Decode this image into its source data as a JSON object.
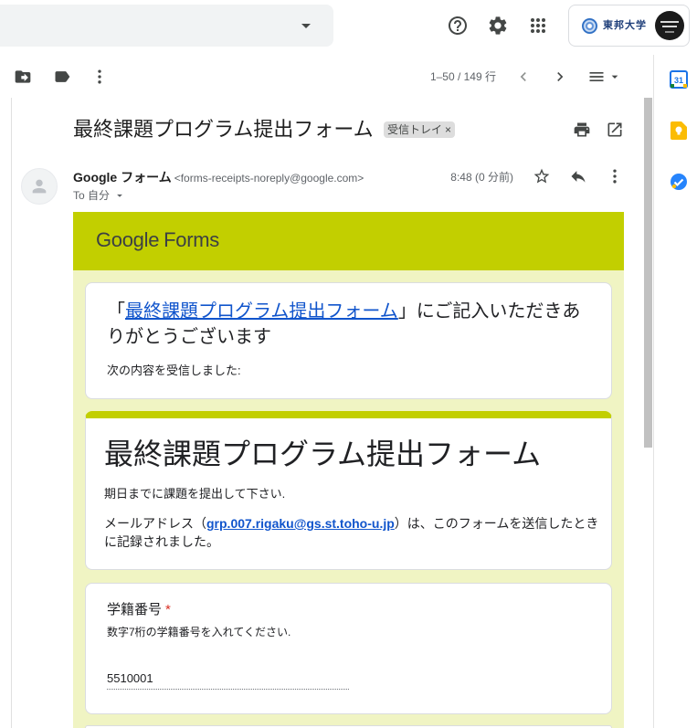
{
  "header": {
    "account": {
      "org_name": "東邦大学"
    },
    "icons": [
      "search-options-icon",
      "help-icon",
      "settings-icon",
      "apps-icon"
    ]
  },
  "toolbar": {
    "pagination": "1–50 / 149 行",
    "icons": [
      "move-to-icon",
      "label-icon",
      "more-vert-icon",
      "chevron-left-icon",
      "chevron-right-icon",
      "density-icon"
    ]
  },
  "side_panel": {
    "calendar_day": "31",
    "icons": [
      "calendar-icon",
      "keep-icon",
      "tasks-icon"
    ]
  },
  "email": {
    "subject": "最終課題プログラム提出フォーム",
    "label": "受信トレイ",
    "label_remove": "×",
    "sender_name": "Google フォーム",
    "sender_email": "<forms-receipts-noreply@google.com>",
    "time": "8:48 (0 分前)",
    "to": "To 自分",
    "icons": [
      "print-icon",
      "open-in-new-icon",
      "star-icon",
      "reply-icon",
      "more-vert-icon"
    ]
  },
  "form_email": {
    "brand": {
      "google": "Google",
      "forms": "Forms"
    },
    "thanks": {
      "open": "「",
      "link": "最終課題プログラム提出フォーム",
      "close": "」にご記入いただきありがとうございます"
    },
    "received": "次の内容を受信しました:",
    "form_title": "最終課題プログラム提出フォーム",
    "form_description": "期日までに課題を提出して下さい.",
    "email_notice": {
      "before": "メールアドレス（",
      "email": "grp.007.rigaku@gs.st.toho-u.jp",
      "after": "）は、このフォームを送信したときに記録されました。"
    },
    "questions": [
      {
        "title": "学籍番号",
        "required_mark": "*",
        "description": "数字7桁の学籍番号を入れてください.",
        "answer": "5510001"
      }
    ]
  },
  "colors": {
    "forms_accent": "#c2cf00",
    "forms_background": "#f0f4c3",
    "link": "#1155cc",
    "required": "#d93025"
  }
}
